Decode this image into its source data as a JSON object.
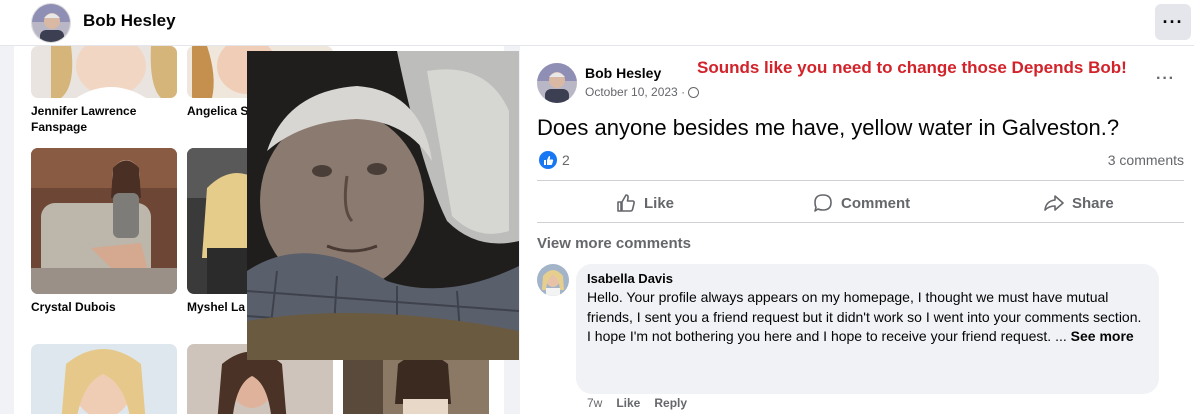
{
  "header": {
    "name": "Bob Hesley",
    "more_label": "···"
  },
  "friends": [
    {
      "name": "Jennifer Lawrence Fanspage"
    },
    {
      "name": "Angelica S"
    },
    {
      "name": "Crystal Dubois"
    },
    {
      "name": "Myshel La"
    }
  ],
  "post": {
    "author": "Bob Hesley",
    "date": "October 10, 2023 ·",
    "annotation": "Sounds like you need to change those Depends Bob!",
    "dots": "···",
    "text": "Does anyone besides me have, yellow water in Galveston.?",
    "like_count": "2",
    "comments_count": "3 comments",
    "actions": {
      "like": "Like",
      "comment": "Comment",
      "share": "Share"
    },
    "view_more": "View more comments"
  },
  "comment": {
    "author": "Isabella Davis",
    "text": "Hello. Your profile always appears on my homepage, I thought we must have mutual friends, I sent you a friend request but it didn't work so I went into your comments section.",
    "text2": "I hope I'm not bothering you here and I hope to receive your friend request. ...",
    "see_more": "See more",
    "time": "7w",
    "like_label": "Like",
    "reply_label": "Reply"
  },
  "colors": {
    "annotation": "#d2232a",
    "like_blue": "#1877f2",
    "secondary_text": "#65676b"
  }
}
